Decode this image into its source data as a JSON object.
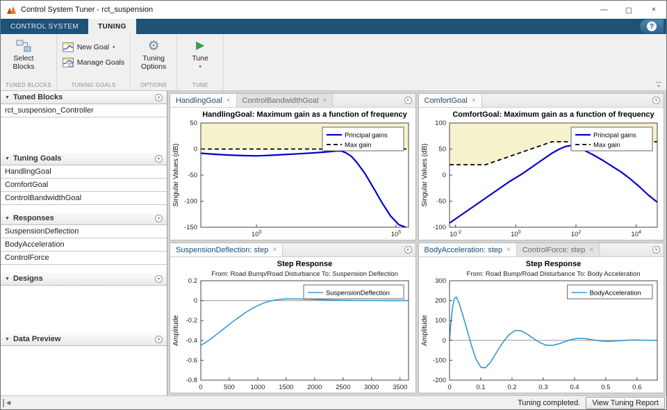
{
  "window": {
    "title": "Control System Tuner - rct_suspension"
  },
  "icons": {
    "minimize": "—",
    "maximize": "▢",
    "close": "×",
    "help": "?",
    "dropdown": "▾",
    "panel_arrow": "▼",
    "circle_action": "▾",
    "play": "▶",
    "gear": "⚙",
    "collapse_ribbon": "▴",
    "scroll_left": "◀",
    "tab_close": "×"
  },
  "colors": {
    "accent_blue": "#1e5276",
    "goal_line_blue": "#0000cd",
    "step_line_blue": "#3497d3",
    "region_yellow": "#f6f2cc",
    "tune_green": "#38a049"
  },
  "ribbon_tabs": [
    {
      "label": "CONTROL SYSTEM",
      "active": false
    },
    {
      "label": "TUNING",
      "active": true
    }
  ],
  "toolbar": {
    "sections": [
      {
        "label": "TUNED BLOCKS",
        "buttons": [
          {
            "label": "Select Blocks"
          }
        ]
      },
      {
        "label": "TUNING GOALS",
        "buttons": [
          {
            "label": "New Goal",
            "dropdown": true
          },
          {
            "label": "Manage Goals"
          }
        ]
      },
      {
        "label": "OPTIONS",
        "buttons": [
          {
            "label": "Tuning Options"
          }
        ]
      },
      {
        "label": "TUNE",
        "buttons": [
          {
            "label": "Tune",
            "dropdown": true
          }
        ]
      }
    ]
  },
  "sidebar": {
    "panels": [
      {
        "title": "Tuned Blocks",
        "items": [
          "rct_suspension_Controller"
        ]
      },
      {
        "title": "Tuning Goals",
        "items": [
          "HandlingGoal",
          "ComfortGoal",
          "ControlBandwidthGoal"
        ]
      },
      {
        "title": "Responses",
        "items": [
          "SuspensionDeflection",
          "BodyAcceleration",
          "ControlForce"
        ]
      },
      {
        "title": "Designs",
        "items": []
      },
      {
        "title": "Data Preview",
        "items": []
      }
    ]
  },
  "documents": [
    {
      "tabs": [
        {
          "label": "HandlingGoal",
          "active": true
        },
        {
          "label": "ControlBandwidthGoal",
          "active": false
        }
      ]
    },
    {
      "tabs": [
        {
          "label": "ComfortGoal",
          "active": true
        }
      ]
    },
    {
      "tabs": [
        {
          "label": "SuspensionDeflection: step",
          "active": true
        }
      ]
    },
    {
      "tabs": [
        {
          "label": "BodyAcceleration: step",
          "active": true
        },
        {
          "label": "ControlForce: step",
          "active": false
        }
      ]
    }
  ],
  "statusbar": {
    "message": "Tuning completed.",
    "button": "View Tuning Report"
  },
  "chart_data": [
    {
      "name": "handlinggoal-frequency",
      "type": "line",
      "title": "HandlingGoal: Maximum gain as a function of frequency",
      "ylabel": "Singular Values (dB)",
      "xscale": "log",
      "xlim": [
        -2,
        5.45
      ],
      "ylim": [
        -150,
        50
      ],
      "xticks": [
        {
          "v": 0,
          "label": "10",
          "exp": "0"
        },
        {
          "v": 5,
          "label": "10",
          "exp": "5"
        }
      ],
      "yticks": [
        {
          "v": 50,
          "label": "50"
        },
        {
          "v": 0,
          "label": "0"
        },
        {
          "v": -50,
          "label": "-50"
        },
        {
          "v": -100,
          "label": "-100"
        },
        {
          "v": -150,
          "label": "-150"
        }
      ],
      "region": {
        "color": "#f6f2cc",
        "points": [
          [
            -2,
            0
          ],
          [
            5.45,
            0
          ],
          [
            5.45,
            50
          ],
          [
            -2,
            50
          ]
        ]
      },
      "series": [
        {
          "name": "Principal gains",
          "color": "#0000cd",
          "width": 2.2,
          "points": [
            [
              -2,
              -8
            ],
            [
              -1.5,
              -10
            ],
            [
              -1,
              -11.5
            ],
            [
              -0.5,
              -12.5
            ],
            [
              0,
              -13
            ],
            [
              0.5,
              -12
            ],
            [
              1,
              -10.5
            ],
            [
              1.5,
              -9
            ],
            [
              2,
              -7.5
            ],
            [
              2.4,
              -6
            ],
            [
              2.7,
              -4.5
            ],
            [
              2.9,
              -3.5
            ],
            [
              3.05,
              -4
            ],
            [
              3.2,
              -7
            ],
            [
              3.4,
              -14
            ],
            [
              3.6,
              -26
            ],
            [
              3.9,
              -48
            ],
            [
              4.2,
              -75
            ],
            [
              4.5,
              -103
            ],
            [
              4.8,
              -128
            ],
            [
              5.1,
              -145
            ],
            [
              5.35,
              -150
            ]
          ]
        },
        {
          "name": "Max gain",
          "color": "#000000",
          "width": 1.8,
          "dash": "6,4",
          "points": [
            [
              -2,
              0
            ],
            [
              5.45,
              0
            ]
          ]
        }
      ]
    },
    {
      "name": "comfortgoal-frequency",
      "type": "line",
      "title": "ComfortGoal: Maximum gain as a function of frequency",
      "ylabel": "Singular Values (dB)",
      "xscale": "log",
      "xlim": [
        -2.2,
        4.7
      ],
      "ylim": [
        -100,
        100
      ],
      "xticks": [
        {
          "v": -2,
          "label": "10",
          "exp": "-2"
        },
        {
          "v": 0,
          "label": "10",
          "exp": "0"
        },
        {
          "v": 2,
          "label": "10",
          "exp": "2"
        },
        {
          "v": 4,
          "label": "10",
          "exp": "4"
        }
      ],
      "yticks": [
        {
          "v": 100,
          "label": "100"
        },
        {
          "v": 50,
          "label": "50"
        },
        {
          "v": 0,
          "label": "0"
        },
        {
          "v": -50,
          "label": "-50"
        },
        {
          "v": -100,
          "label": "-100"
        }
      ],
      "region": {
        "color": "#f6f2cc",
        "points": [
          [
            -2.2,
            20
          ],
          [
            -1,
            20
          ],
          [
            1.2,
            64
          ],
          [
            4.7,
            64
          ],
          [
            4.7,
            100
          ],
          [
            -2.2,
            100
          ]
        ]
      },
      "series": [
        {
          "name": "Principal gains",
          "color": "#0000cd",
          "width": 2.2,
          "points": [
            [
              -2.2,
              -92
            ],
            [
              -1.8,
              -76
            ],
            [
              -1.4,
              -60
            ],
            [
              -1,
              -44
            ],
            [
              -0.6,
              -28
            ],
            [
              -0.2,
              -12
            ],
            [
              0.2,
              2
            ],
            [
              0.6,
              18
            ],
            [
              0.9,
              30
            ],
            [
              1.2,
              42
            ],
            [
              1.45,
              50
            ],
            [
              1.65,
              55
            ],
            [
              1.85,
              57
            ],
            [
              2.05,
              54
            ],
            [
              2.3,
              47
            ],
            [
              2.6,
              38
            ],
            [
              2.9,
              28
            ],
            [
              3.2,
              17
            ],
            [
              3.5,
              6
            ],
            [
              3.8,
              -7
            ],
            [
              4.1,
              -22
            ],
            [
              4.4,
              -38
            ],
            [
              4.7,
              -52
            ]
          ]
        },
        {
          "name": "Max gain",
          "color": "#000000",
          "width": 1.8,
          "dash": "6,4",
          "points": [
            [
              -2.2,
              20
            ],
            [
              -1,
              20
            ],
            [
              1.2,
              64
            ],
            [
              4.7,
              64
            ]
          ]
        }
      ]
    },
    {
      "name": "suspensiondeflection-step",
      "type": "line",
      "title": "Step Response",
      "subtitle": "From: Road Bump/Road Disturbance  To: Suspension Deflection",
      "ylabel": "Amplitude",
      "xscale": "linear",
      "xlim": [
        0,
        3650
      ],
      "ylim": [
        -0.8,
        0.2
      ],
      "zeroline": true,
      "xticks": [
        {
          "v": 0,
          "label": "0"
        },
        {
          "v": 500,
          "label": "500"
        },
        {
          "v": 1000,
          "label": "1000"
        },
        {
          "v": 1500,
          "label": "1500"
        },
        {
          "v": 2000,
          "label": "2000"
        },
        {
          "v": 2500,
          "label": "2500"
        },
        {
          "v": 3000,
          "label": "3000"
        },
        {
          "v": 3500,
          "label": "3500"
        }
      ],
      "yticks": [
        {
          "v": 0.2,
          "label": "0.2"
        },
        {
          "v": 0,
          "label": "0"
        },
        {
          "v": -0.2,
          "label": "-0.2"
        },
        {
          "v": -0.4,
          "label": "-0.4"
        },
        {
          "v": -0.6,
          "label": "-0.6"
        },
        {
          "v": -0.8,
          "label": "-0.8"
        }
      ],
      "series": [
        {
          "name": "SuspensionDeflection",
          "color": "#3497d3",
          "width": 1.6,
          "points": [
            [
              0,
              -0.45
            ],
            [
              100,
              -0.415
            ],
            [
              200,
              -0.375
            ],
            [
              300,
              -0.33
            ],
            [
              400,
              -0.285
            ],
            [
              500,
              -0.24
            ],
            [
              600,
              -0.195
            ],
            [
              700,
              -0.155
            ],
            [
              800,
              -0.115
            ],
            [
              900,
              -0.08
            ],
            [
              1000,
              -0.05
            ],
            [
              1100,
              -0.025
            ],
            [
              1200,
              -0.007
            ],
            [
              1300,
              0.005
            ],
            [
              1400,
              0.013
            ],
            [
              1500,
              0.017
            ],
            [
              1650,
              0.018
            ],
            [
              1800,
              0.015
            ],
            [
              2000,
              0.011
            ],
            [
              2200,
              0.007
            ],
            [
              2500,
              0.003
            ],
            [
              2800,
              0.001
            ],
            [
              3200,
              0
            ],
            [
              3650,
              0
            ]
          ]
        }
      ]
    },
    {
      "name": "bodyacceleration-step",
      "type": "line",
      "title": "Step Response",
      "subtitle": "From: Road Bump/Road Disturbance  To: Body Acceleration",
      "ylabel": "Amplitude",
      "xscale": "linear",
      "xlim": [
        0,
        0.665
      ],
      "ylim": [
        -200,
        300
      ],
      "zeroline": true,
      "xticks": [
        {
          "v": 0,
          "label": "0"
        },
        {
          "v": 0.1,
          "label": "0.1"
        },
        {
          "v": 0.2,
          "label": "0.2"
        },
        {
          "v": 0.3,
          "label": "0.3"
        },
        {
          "v": 0.4,
          "label": "0.4"
        },
        {
          "v": 0.5,
          "label": "0.5"
        },
        {
          "v": 0.6,
          "label": "0.6"
        }
      ],
      "yticks": [
        {
          "v": 300,
          "label": "300"
        },
        {
          "v": 200,
          "label": "200"
        },
        {
          "v": 100,
          "label": "100"
        },
        {
          "v": 0,
          "label": "0"
        },
        {
          "v": -100,
          "label": "-100"
        },
        {
          "v": -200,
          "label": "-200"
        }
      ],
      "series": [
        {
          "name": "BodyAcceleration",
          "color": "#3497d3",
          "width": 1.6,
          "points": [
            [
              0,
              0
            ],
            [
              0.004,
              80
            ],
            [
              0.01,
              170
            ],
            [
              0.016,
              212
            ],
            [
              0.022,
              218
            ],
            [
              0.03,
              190
            ],
            [
              0.04,
              140
            ],
            [
              0.055,
              60
            ],
            [
              0.07,
              -25
            ],
            [
              0.085,
              -95
            ],
            [
              0.1,
              -135
            ],
            [
              0.115,
              -138
            ],
            [
              0.13,
              -112
            ],
            [
              0.15,
              -62
            ],
            [
              0.17,
              -12
            ],
            [
              0.19,
              28
            ],
            [
              0.21,
              50
            ],
            [
              0.23,
              48
            ],
            [
              0.25,
              30
            ],
            [
              0.27,
              8
            ],
            [
              0.29,
              -12
            ],
            [
              0.31,
              -24
            ],
            [
              0.33,
              -25
            ],
            [
              0.35,
              -17
            ],
            [
              0.37,
              -6
            ],
            [
              0.39,
              4
            ],
            [
              0.41,
              10
            ],
            [
              0.43,
              10
            ],
            [
              0.45,
              5
            ],
            [
              0.47,
              0
            ],
            [
              0.49,
              -4
            ],
            [
              0.51,
              -5
            ],
            [
              0.53,
              -3
            ],
            [
              0.56,
              0
            ],
            [
              0.59,
              2
            ],
            [
              0.62,
              1
            ],
            [
              0.665,
              0
            ]
          ]
        }
      ]
    }
  ]
}
